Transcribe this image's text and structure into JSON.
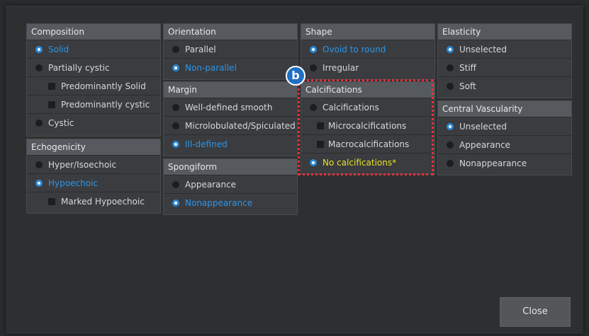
{
  "composition": {
    "title": "Composition",
    "options": [
      "Solid",
      "Partially cystic",
      "Predominantly Solid",
      "Predominantly cystic",
      "Cystic"
    ]
  },
  "echogenicity": {
    "title": "Echogenicity",
    "options": [
      "Hyper/Isoechoic",
      "Hypoechoic",
      "Marked Hypoechoic"
    ]
  },
  "orientation": {
    "title": "Orientation",
    "options": [
      "Parallel",
      "Non-parallel"
    ]
  },
  "margin": {
    "title": "Margin",
    "options": [
      "Well-defined smooth",
      "Microlobulated/Spiculated",
      "Ill-defined"
    ]
  },
  "spongiform": {
    "title": "Spongiform",
    "options": [
      "Appearance",
      "Nonappearance"
    ]
  },
  "shape": {
    "title": "Shape",
    "options": [
      "Ovoid to round",
      "Irregular"
    ]
  },
  "calcifications": {
    "title": "Calcifications",
    "options": [
      "Calcifications",
      "Microcalcifications",
      "Macrocalcifications",
      "No calcifications*"
    ]
  },
  "elasticity": {
    "title": "Elasticity",
    "options": [
      "Unselected",
      "Stiff",
      "Soft"
    ]
  },
  "central_vascularity": {
    "title": "Central Vascularity",
    "options": [
      "Unselected",
      "Appearance",
      "Nonappearance"
    ]
  },
  "annotation": {
    "badge_letter": "b"
  },
  "buttons": {
    "close": "Close"
  },
  "colors": {
    "selected_blue": "#2e95e8",
    "highlight_yellow": "#e8e02a",
    "annotation_red": "#e8323c",
    "badge_blue": "#1f6fc2"
  }
}
